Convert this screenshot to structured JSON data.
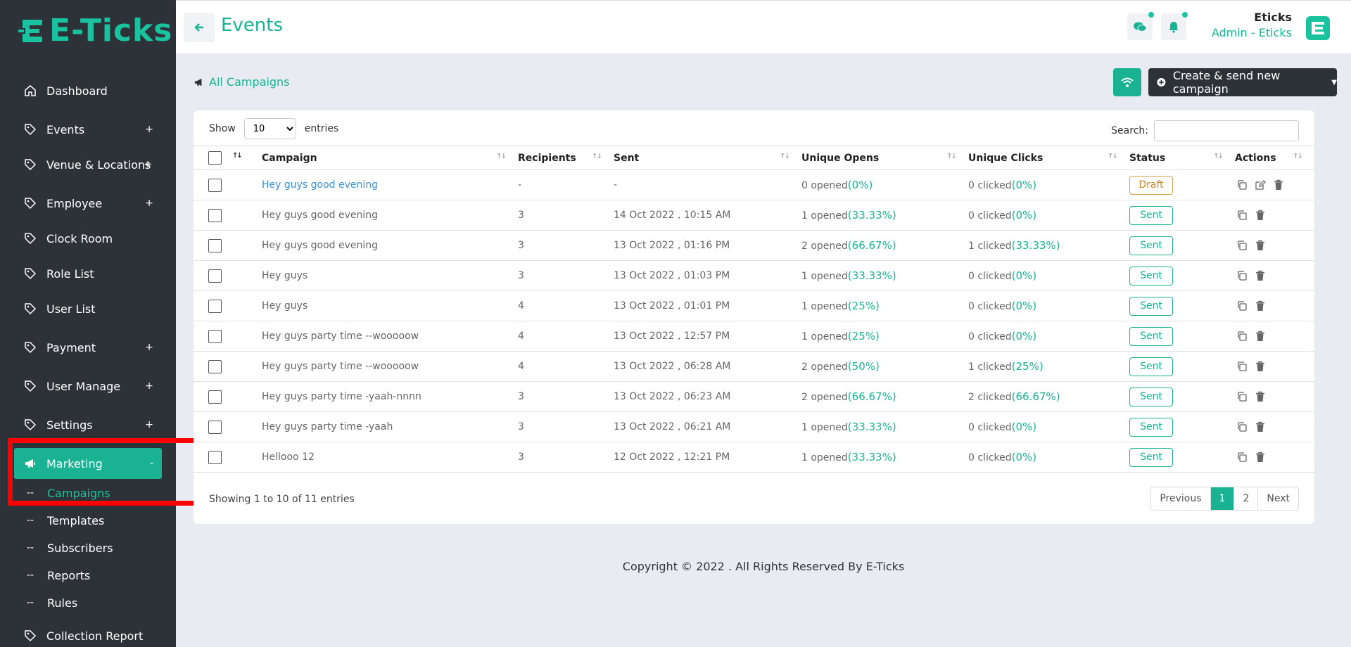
{
  "brand": {
    "logo_text": "E-Ticks"
  },
  "sidebar": {
    "items": [
      {
        "label": "Dashboard",
        "plus": ""
      },
      {
        "label": "Events",
        "plus": "+"
      },
      {
        "label": "Venue & Locations",
        "plus": "+"
      },
      {
        "label": "Employee",
        "plus": "+"
      },
      {
        "label": "Clock Room",
        "plus": ""
      },
      {
        "label": "Role List",
        "plus": ""
      },
      {
        "label": "User List",
        "plus": ""
      },
      {
        "label": "Payment",
        "plus": "+"
      },
      {
        "label": "User Manage",
        "plus": "+"
      },
      {
        "label": "Settings",
        "plus": "+"
      },
      {
        "label": "Marketing",
        "plus": "-"
      },
      {
        "label": "Collection Report",
        "plus": ""
      }
    ],
    "sub_items": [
      {
        "dash": "--",
        "label": "Campaigns"
      },
      {
        "dash": "--",
        "label": "Templates"
      },
      {
        "dash": "--",
        "label": "Subscribers"
      },
      {
        "dash": "--",
        "label": "Reports"
      },
      {
        "dash": "--",
        "label": "Rules"
      }
    ]
  },
  "header": {
    "title": "Events",
    "user_name": "Eticks",
    "user_role": "Admin - Eticks"
  },
  "breadcrumb": {
    "label": "All Campaigns"
  },
  "toolbar": {
    "create_label": "Create & send new campaign"
  },
  "table": {
    "show_label": "Show",
    "entries_label": "entries",
    "page_size": "10",
    "search_label": "Search:",
    "columns": [
      "Campaign",
      "Recipients",
      "Sent",
      "Unique Opens",
      "Unique Clicks",
      "Status",
      "Actions"
    ],
    "rows": [
      {
        "campaign": "Hey guys good evening",
        "recipients": "-",
        "sent": "-",
        "opens": "0 opened",
        "opens_pct": "(0%)",
        "clicks": "0 clicked",
        "clicks_pct": "(0%)",
        "status": "Draft"
      },
      {
        "campaign": "Hey guys good evening",
        "recipients": "3",
        "sent": "14 Oct 2022 , 10:15 AM",
        "opens": "1 opened",
        "opens_pct": "(33.33%)",
        "clicks": "0 clicked",
        "clicks_pct": "(0%)",
        "status": "Sent"
      },
      {
        "campaign": "Hey guys good evening",
        "recipients": "3",
        "sent": "13 Oct 2022 , 01:16 PM",
        "opens": "2 opened",
        "opens_pct": "(66.67%)",
        "clicks": "1 clicked",
        "clicks_pct": "(33.33%)",
        "status": "Sent"
      },
      {
        "campaign": "Hey guys",
        "recipients": "3",
        "sent": "13 Oct 2022 , 01:03 PM",
        "opens": "1 opened",
        "opens_pct": "(33.33%)",
        "clicks": "0 clicked",
        "clicks_pct": "(0%)",
        "status": "Sent"
      },
      {
        "campaign": "Hey guys",
        "recipients": "4",
        "sent": "13 Oct 2022 , 01:01 PM",
        "opens": "1 opened",
        "opens_pct": "(25%)",
        "clicks": "0 clicked",
        "clicks_pct": "(0%)",
        "status": "Sent"
      },
      {
        "campaign": "Hey guys party time --wooooow",
        "recipients": "4",
        "sent": "13 Oct 2022 , 12:57 PM",
        "opens": "1 opened",
        "opens_pct": "(25%)",
        "clicks": "0 clicked",
        "clicks_pct": "(0%)",
        "status": "Sent"
      },
      {
        "campaign": "Hey guys party time --wooooow",
        "recipients": "4",
        "sent": "13 Oct 2022 , 06:28 AM",
        "opens": "2 opened",
        "opens_pct": "(50%)",
        "clicks": "1 clicked",
        "clicks_pct": "(25%)",
        "status": "Sent"
      },
      {
        "campaign": "Hey guys party time -yaah-nnnn",
        "recipients": "3",
        "sent": "13 Oct 2022 , 06:23 AM",
        "opens": "2 opened",
        "opens_pct": "(66.67%)",
        "clicks": "2 clicked",
        "clicks_pct": "(66.67%)",
        "status": "Sent"
      },
      {
        "campaign": "Hey guys party time -yaah",
        "recipients": "3",
        "sent": "13 Oct 2022 , 06:21 AM",
        "opens": "1 opened",
        "opens_pct": "(33.33%)",
        "clicks": "0 clicked",
        "clicks_pct": "(0%)",
        "status": "Sent"
      },
      {
        "campaign": "Hellooo 12",
        "recipients": "3",
        "sent": "12 Oct 2022 , 12:21 PM",
        "opens": "1 opened",
        "opens_pct": "(33.33%)",
        "clicks": "0 clicked",
        "clicks_pct": "(0%)",
        "status": "Sent"
      }
    ],
    "showing_text": "Showing 1 to 10 of 11 entries"
  },
  "pagination": {
    "previous": "Previous",
    "pages": [
      "1",
      "2"
    ],
    "next": "Next"
  },
  "footer": {
    "text": "Copyright © 2022 . All Rights Reserved By E-Ticks"
  },
  "colors": {
    "accent": "#19b394",
    "sidebar_bg": "#2d3238",
    "draft": "#c88a2a",
    "highlight": "#ff0000"
  }
}
